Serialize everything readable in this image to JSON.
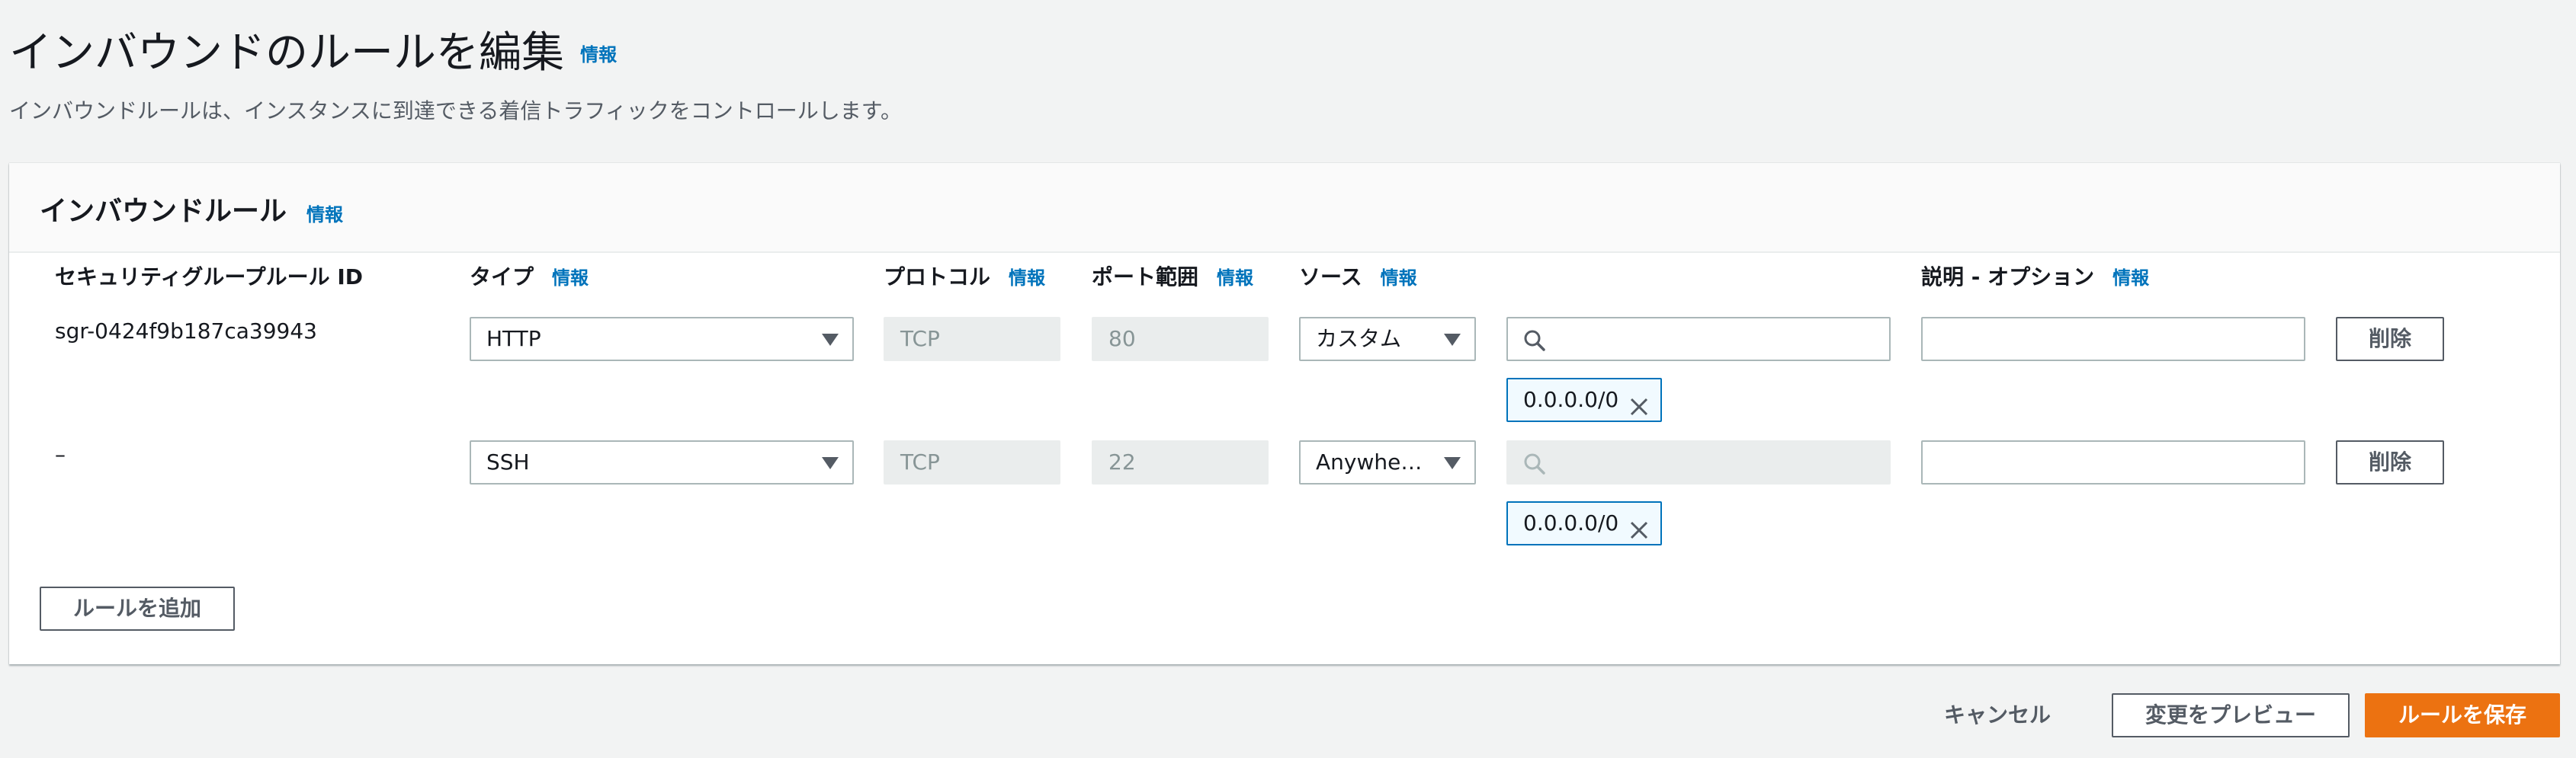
{
  "page": {
    "title": "インバウンドのルールを編集",
    "info": "情報",
    "description": "インバウンドルールは、インスタンスに到達できる着信トラフィックをコントロールします。"
  },
  "panel": {
    "title": "インバウンドルール",
    "info": "情報",
    "columns": {
      "rule_id": "セキュリティグループルール ID",
      "type": "タイプ",
      "protocol": "プロトコル",
      "port": "ポート範囲",
      "source": "ソース",
      "description": "説明 - オプション"
    },
    "column_info": "情報",
    "rules": [
      {
        "rule_id": "sgr-0424f9b187ca39943",
        "type": "HTTP",
        "protocol": "TCP",
        "port": "80",
        "source": "カスタム",
        "search_placeholder": "",
        "cidr": "0.0.0.0/0",
        "description": "",
        "delete_label": "削除"
      },
      {
        "rule_id": "–",
        "type": "SSH",
        "protocol": "TCP",
        "port": "22",
        "source": "Anywhere...",
        "search_placeholder": "",
        "cidr": "0.0.0.0/0",
        "description": "",
        "delete_label": "削除"
      }
    ],
    "add_rule_label": "ルールを追加"
  },
  "footer": {
    "cancel_label": "キャンセル",
    "preview_label": "変更をプレビュー",
    "save_label": "ルールを保存"
  },
  "colors": {
    "link": "#0073bb",
    "primary": "#ec7211",
    "background": "#f2f3f3"
  },
  "icons": [
    "search-icon",
    "close-icon",
    "caret-down-icon"
  ]
}
